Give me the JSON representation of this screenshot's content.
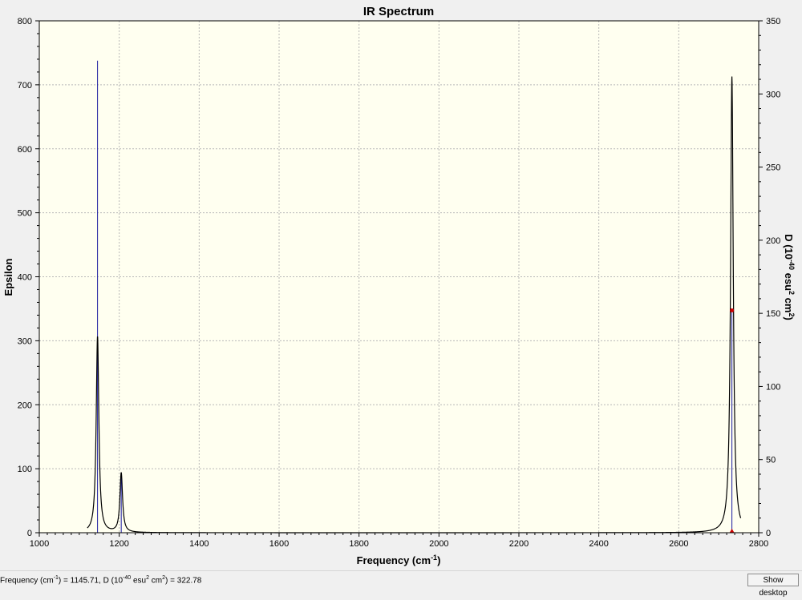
{
  "chart_data": {
    "type": "line",
    "title": "IR Spectrum",
    "xlabel": "Frequency (cm",
    "xlabel_sup": "-1",
    "xlabel_tail": ")",
    "ylabel": "Epsilon",
    "y2label": "D (10",
    "y2label_sup": "-40",
    "y2label_mid": " esu",
    "y2label_sup2": "2",
    "y2label_mid2": " cm",
    "y2label_sup3": "2",
    "y2label_tail": ")",
    "xlim": [
      1000,
      2800
    ],
    "ylim": [
      0,
      800
    ],
    "y2lim": [
      0,
      350
    ],
    "x_ticks": [
      1000,
      1200,
      1400,
      1600,
      1800,
      2000,
      2200,
      2400,
      2600,
      2800
    ],
    "y_ticks": [
      0,
      100,
      200,
      300,
      400,
      500,
      600,
      700,
      800
    ],
    "y2_ticks": [
      0,
      50,
      100,
      150,
      200,
      250,
      300,
      350
    ],
    "grid": true,
    "background": "#fffff0",
    "curve_color": "#000000",
    "stick_color": "#1a1aa0",
    "marker_color": "#cc0000",
    "line_width_hz": 4,
    "spectrum_range": [
      1120,
      2755
    ],
    "peaks": [
      {
        "frequency": 1145.71,
        "epsilon": 307,
        "D": 322.78
      },
      {
        "frequency": 1205,
        "epsilon": 93,
        "D": 40
      },
      {
        "frequency": 2733,
        "epsilon": 713,
        "D": 152
      }
    ],
    "selected_peak": {
      "frequency": 1145.71,
      "D": 322.78
    }
  },
  "status": {
    "part1": "Frequency (cm",
    "sup1": "-1",
    "part2": ") = 1145.71, D (10",
    "sup2": "-40",
    "part3": " esu",
    "sup3": "2",
    "part4": " cm",
    "sup4": "2",
    "part5": ") = 322.78"
  },
  "show_desktop_label": "Show desktop"
}
